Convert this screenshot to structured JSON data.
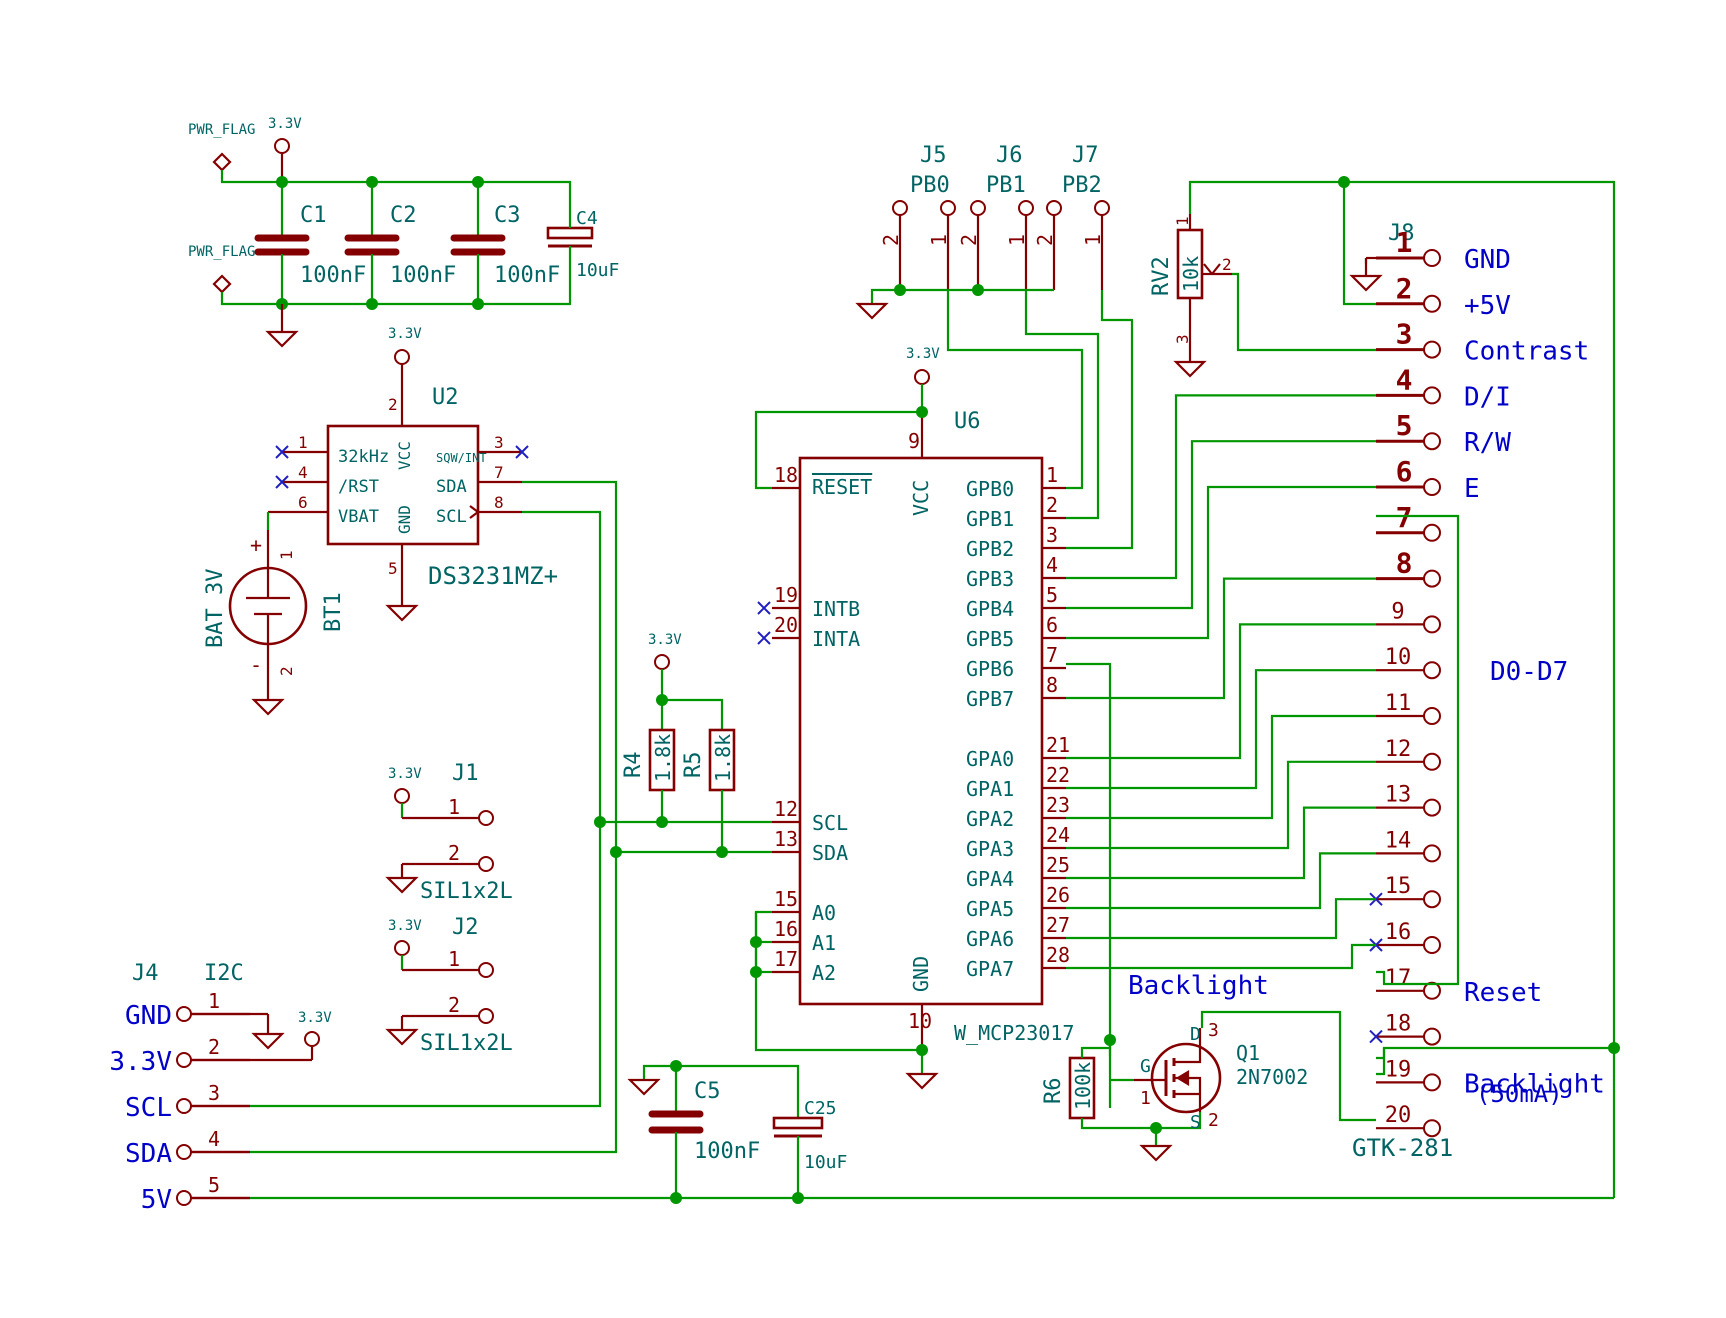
{
  "power": {
    "pwr_flag": "PWR_FLAG",
    "v33": "3.3V"
  },
  "caps": {
    "c1": {
      "ref": "C1",
      "value": "100nF"
    },
    "c2": {
      "ref": "C2",
      "value": "100nF"
    },
    "c3": {
      "ref": "C3",
      "value": "100nF"
    },
    "c4": {
      "ref": "C4",
      "value": "10uF"
    },
    "c5": {
      "ref": "C5",
      "value": "100nF"
    },
    "c25": {
      "ref": "C25",
      "value": "10uF"
    }
  },
  "u2": {
    "ref": "U2",
    "value": "DS3231MZ+",
    "pins": {
      "p32k": "32kHz",
      "rst": "/RST",
      "vbat": "VBAT",
      "vcc": "VCC",
      "gnd": "GND",
      "sqw": "SQW/INT",
      "sda": "SDA",
      "scl": "SCL"
    },
    "nums": {
      "n1": "1",
      "n2": "2",
      "n3": "3",
      "n4": "4",
      "n5": "5",
      "n6": "6",
      "n7": "7",
      "n8": "8"
    }
  },
  "bt1": {
    "ref": "BT1",
    "value": "BAT 3V",
    "plus": "+",
    "minus": "-",
    "n1": "1",
    "n2": "2"
  },
  "u6": {
    "ref": "U6",
    "value": "W_MCP23017",
    "reset": "RESET",
    "vcc": "VCC",
    "gnd": "GND",
    "left_pins": [
      {
        "num": "18",
        "name": ""
      },
      {
        "num": "19",
        "name": "INTB"
      },
      {
        "num": "20",
        "name": "INTA"
      },
      {
        "num": "12",
        "name": "SCL"
      },
      {
        "num": "13",
        "name": "SDA"
      },
      {
        "num": "15",
        "name": "A0"
      },
      {
        "num": "16",
        "name": "A1"
      },
      {
        "num": "17",
        "name": "A2"
      }
    ],
    "right_pins": [
      {
        "num": "1",
        "name": "GPB0"
      },
      {
        "num": "2",
        "name": "GPB1"
      },
      {
        "num": "3",
        "name": "GPB2"
      },
      {
        "num": "4",
        "name": "GPB3"
      },
      {
        "num": "5",
        "name": "GPB4"
      },
      {
        "num": "6",
        "name": "GPB5"
      },
      {
        "num": "7",
        "name": "GPB6"
      },
      {
        "num": "8",
        "name": "GPB7"
      },
      {
        "num": "21",
        "name": "GPA0"
      },
      {
        "num": "22",
        "name": "GPA1"
      },
      {
        "num": "23",
        "name": "GPA2"
      },
      {
        "num": "24",
        "name": "GPA3"
      },
      {
        "num": "25",
        "name": "GPA4"
      },
      {
        "num": "26",
        "name": "GPA5"
      },
      {
        "num": "27",
        "name": "GPA6"
      },
      {
        "num": "28",
        "name": "GPA7"
      }
    ],
    "top_num": "9",
    "bottom_num": "10"
  },
  "pb": {
    "j5": {
      "ref": "J5",
      "value": "PB0"
    },
    "j6": {
      "ref": "J6",
      "value": "PB1"
    },
    "j7": {
      "ref": "J7",
      "value": "PB2"
    },
    "n1": "1",
    "n2": "2"
  },
  "rv2": {
    "ref": "RV2",
    "value": "10k",
    "n1": "1",
    "n2": "2",
    "n3": "3"
  },
  "r4": {
    "ref": "R4",
    "value": "1.8k"
  },
  "r5": {
    "ref": "R5",
    "value": "1.8k"
  },
  "r6": {
    "ref": "R6",
    "value": "100k"
  },
  "q1": {
    "ref": "Q1",
    "value": "2N7002",
    "g": "G",
    "d": "D",
    "s": "S",
    "n1": "1",
    "n2": "2",
    "n3": "3"
  },
  "j1": {
    "ref": "J1",
    "value": "SIL1x2L",
    "n1": "1",
    "n2": "2"
  },
  "j2": {
    "ref": "J2",
    "value": "SIL1x2L",
    "n1": "1",
    "n2": "2"
  },
  "j4": {
    "ref": "J4",
    "value": "I2C",
    "pins": [
      {
        "num": "1",
        "label": "GND"
      },
      {
        "num": "2",
        "label": "3.3V"
      },
      {
        "num": "3",
        "label": "SCL"
      },
      {
        "num": "4",
        "label": "SDA"
      },
      {
        "num": "5",
        "label": "5V"
      }
    ]
  },
  "j8": {
    "ref": "J8",
    "value": "GTK-281",
    "pins": [
      {
        "num": "1",
        "label": "GND"
      },
      {
        "num": "2",
        "label": "+5V"
      },
      {
        "num": "3",
        "label": "Contrast"
      },
      {
        "num": "4",
        "label": "D/I"
      },
      {
        "num": "5",
        "label": "R/W"
      },
      {
        "num": "6",
        "label": "E"
      },
      {
        "num": "7",
        "label": ""
      },
      {
        "num": "8",
        "label": ""
      },
      {
        "num": "9",
        "label": ""
      },
      {
        "num": "10",
        "label": ""
      },
      {
        "num": "11",
        "label": ""
      },
      {
        "num": "12",
        "label": ""
      },
      {
        "num": "13",
        "label": ""
      },
      {
        "num": "14",
        "label": ""
      },
      {
        "num": "15",
        "label": ""
      },
      {
        "num": "16",
        "label": ""
      },
      {
        "num": "17",
        "label": "Reset"
      },
      {
        "num": "18",
        "label": ""
      },
      {
        "num": "19",
        "label": "Backlight"
      },
      {
        "num": "20",
        "label": ""
      }
    ],
    "d_label": "D0-D7",
    "backlight_note": "(50mA)",
    "backlight_title": "Backlight"
  },
  "colors": {
    "wire": "#009600",
    "part": "#840000",
    "ref_text": "#006464",
    "label_text": "#0000c8"
  }
}
